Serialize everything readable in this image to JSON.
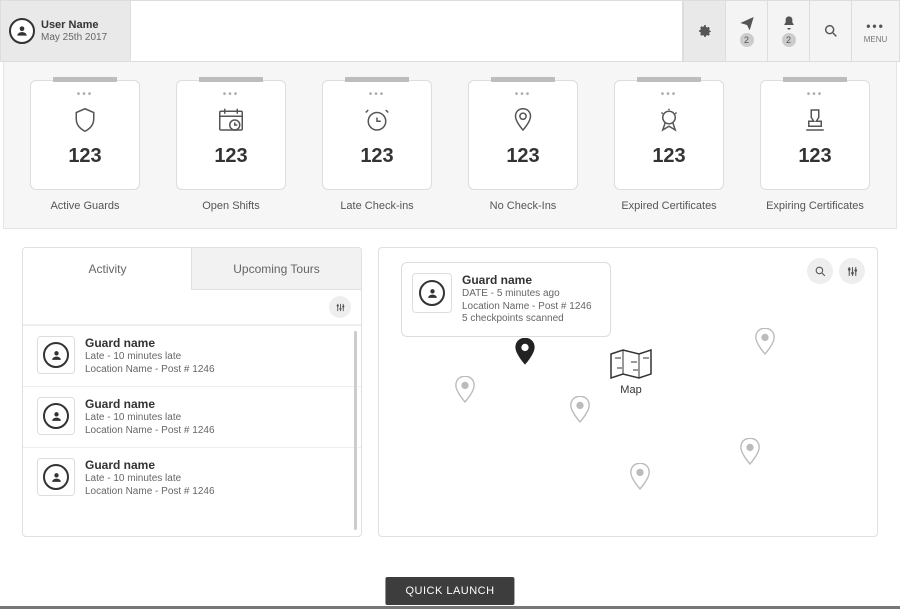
{
  "header": {
    "user_name": "User Name",
    "user_date": "May 25th 2017",
    "menu_label": "MENU",
    "send_badge": "2",
    "bell_badge": "2"
  },
  "stats": {
    "ellipsis": "•••",
    "items": [
      {
        "value": "123",
        "label": "Active Guards"
      },
      {
        "value": "123",
        "label": "Open Shifts"
      },
      {
        "value": "123",
        "label": "Late Check-ins"
      },
      {
        "value": "123",
        "label": "No Check-Ins"
      },
      {
        "value": "123",
        "label": "Expired Certificates"
      },
      {
        "value": "123",
        "label": "Expiring Certificates"
      }
    ]
  },
  "tabs": {
    "activity": "Activity",
    "upcoming": "Upcoming Tours"
  },
  "activity_list": {
    "items": [
      {
        "title": "Guard name",
        "line1": "Late - 10 minutes late",
        "line2": "Location Name - Post # 1246"
      },
      {
        "title": "Guard name",
        "line1": "Late - 10 minutes late",
        "line2": "Location Name - Post # 1246"
      },
      {
        "title": "Guard name",
        "line1": "Late - 10 minutes late",
        "line2": "Location Name - Post # 1246"
      }
    ]
  },
  "popup": {
    "title": "Guard name",
    "line1": "DATE - 5 minutes ago",
    "line2": "Location Name - Post # 1246",
    "line3": "5 checkpoints scanned"
  },
  "map": {
    "label": "Map"
  },
  "footer": {
    "quick_launch": "QUICK LAUNCH"
  }
}
